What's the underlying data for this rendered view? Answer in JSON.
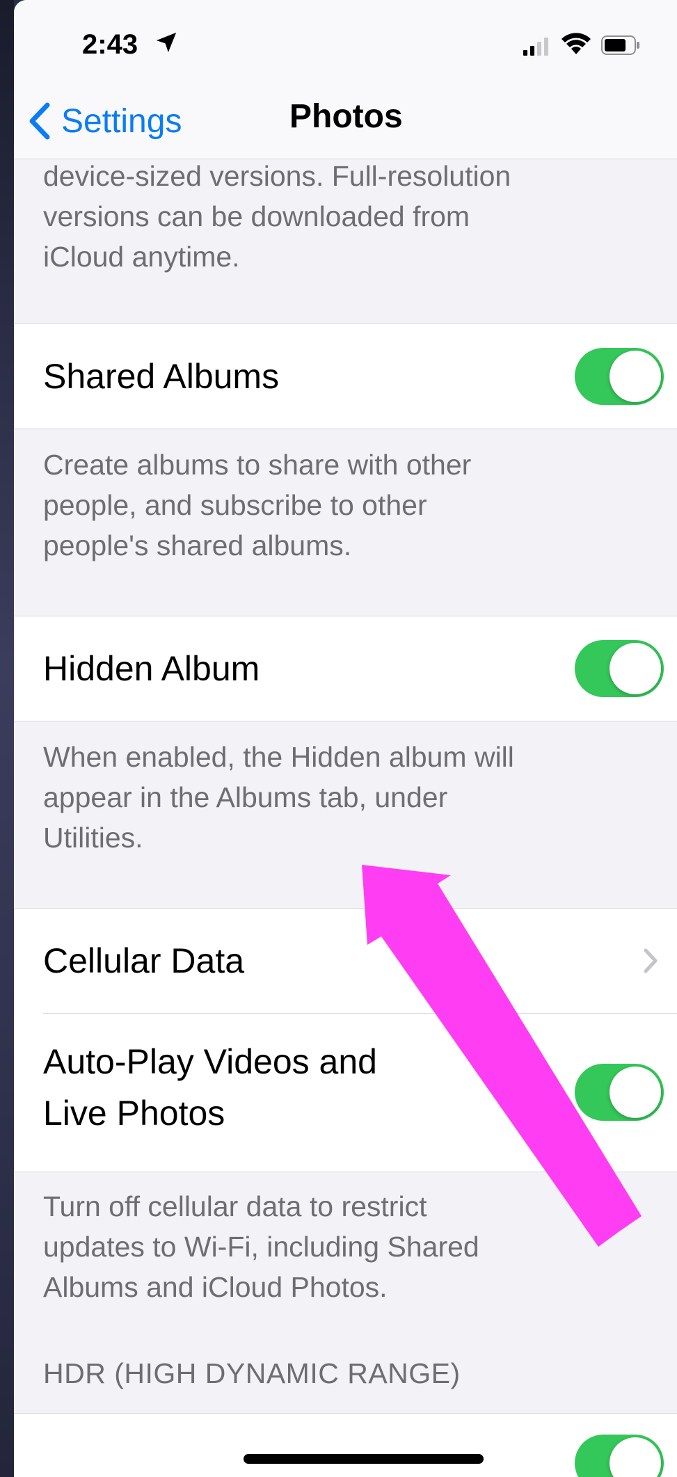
{
  "status_bar": {
    "time": "2:43"
  },
  "nav": {
    "back_label": "Settings",
    "title": "Photos"
  },
  "top_footer": {
    "lines": [
      "device-sized versions. Full-resolution",
      "versions can be downloaded from",
      "iCloud anytime."
    ]
  },
  "shared_albums": {
    "label": "Shared Albums",
    "enabled": true,
    "footer_lines": [
      "Create albums to share with other",
      "people, and subscribe to other",
      "people's shared albums."
    ]
  },
  "hidden_album": {
    "label": "Hidden Album",
    "enabled": true,
    "footer_lines": [
      "When enabled, the Hidden album will",
      "appear in the Albums tab, under",
      "Utilities."
    ]
  },
  "cellular_data": {
    "label": "Cellular Data"
  },
  "autoplay": {
    "label_lines": [
      "Auto-Play Videos and",
      "Live Photos"
    ],
    "enabled": true,
    "footer_lines": [
      "Turn off cellular data to restrict",
      "updates to Wi-Fi, including Shared",
      "Albums and iCloud Photos."
    ]
  },
  "hdr_section": {
    "header": "HDR (HIGH DYNAMIC RANGE)",
    "toggle_enabled": true
  },
  "colors": {
    "accent": "#0a7cf5",
    "toggle_on": "#34c759",
    "annotation_arrow": "#ff3df2"
  }
}
